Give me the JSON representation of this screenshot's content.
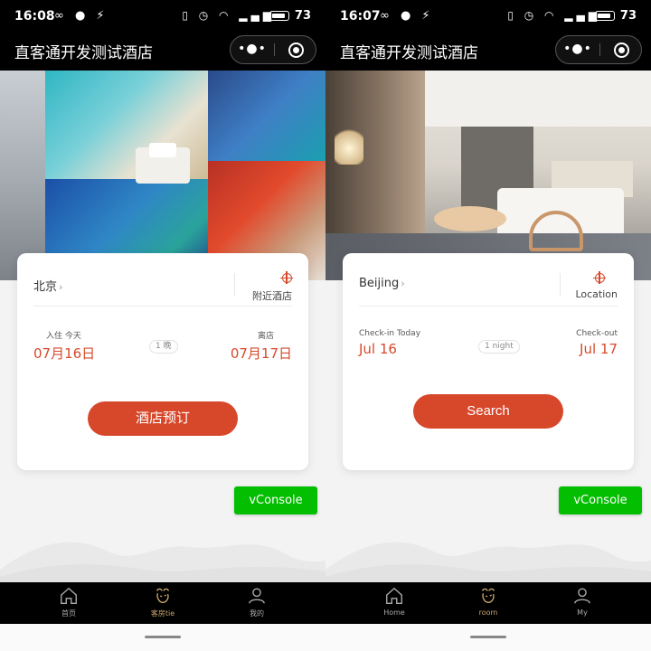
{
  "screens": [
    {
      "status": {
        "time": "16:08",
        "battery": "73"
      },
      "nav_title": "直客通开发测试酒店",
      "city": "北京",
      "nearby_label": "附近酒店",
      "checkin_label": "入住 今天",
      "checkin_date": "07月16日",
      "nights": "1 晚",
      "checkout_label": "离店",
      "checkout_date": "07月17日",
      "search_label": "酒店预订",
      "vconsole": "vConsole",
      "tabs": [
        {
          "label": "首页",
          "icon": "home-icon"
        },
        {
          "label": "客房tie",
          "icon": "room-icon"
        },
        {
          "label": "我的",
          "icon": "user-icon"
        }
      ]
    },
    {
      "status": {
        "time": "16:07",
        "battery": "73"
      },
      "nav_title": "直客通开发测试酒店",
      "city": "Beijing",
      "nearby_label": "Location",
      "checkin_label": "Check-in Today",
      "checkin_date": "Jul 16",
      "nights": "1 night",
      "checkout_label": "Check-out",
      "checkout_date": "Jul 17",
      "search_label": "Search",
      "vconsole": "vConsole",
      "tabs": [
        {
          "label": "Home",
          "icon": "home-icon"
        },
        {
          "label": "room",
          "icon": "room-icon"
        },
        {
          "label": "My",
          "icon": "user-icon"
        }
      ]
    }
  ],
  "colors": {
    "accent": "#d7482b",
    "vconsole": "#04be02",
    "tab_active": "#c9a56a"
  }
}
